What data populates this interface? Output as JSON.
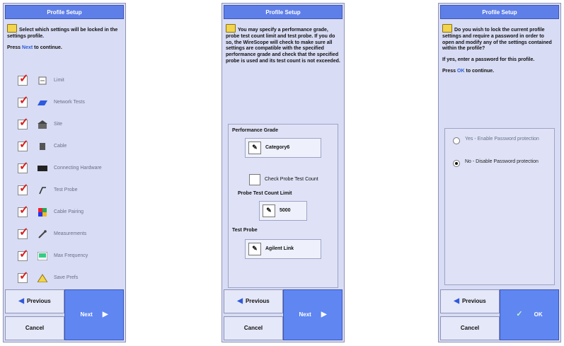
{
  "screen1": {
    "title": "Profile Setup",
    "intro": "Select which settings will be locked in the settings profile.",
    "press_prefix": "Press",
    "press_key": "Next",
    "press_suffix": "to continue.",
    "items": [
      {
        "label": "Limit",
        "icon": "limit-icon",
        "checked": true
      },
      {
        "label": "Network Tests",
        "icon": "network-tests-icon",
        "checked": true
      },
      {
        "label": "Site",
        "icon": "site-icon",
        "checked": true
      },
      {
        "label": "Cable",
        "icon": "cable-icon",
        "checked": true
      },
      {
        "label": "Connecting Hardware",
        "icon": "connecting-hardware-icon",
        "checked": true
      },
      {
        "label": "Test Probe",
        "icon": "test-probe-icon",
        "checked": true
      },
      {
        "label": "Cable Pairing",
        "icon": "cable-pairing-icon",
        "checked": true
      },
      {
        "label": "Measurements",
        "icon": "measurements-icon",
        "checked": true
      },
      {
        "label": "Max Frequency",
        "icon": "max-frequency-icon",
        "checked": true
      },
      {
        "label": "Save Prefs",
        "icon": "save-prefs-icon",
        "checked": true
      }
    ],
    "previous_label": "Previous",
    "cancel_label": "Cancel",
    "next_label": "Next"
  },
  "screen2": {
    "title": "Profile Setup",
    "intro": "You may specify a performance grade, probe test count limit and test probe. If you do so, the WireScope will check to make sure all settings are compatible with the specified performance grade and check that the specified probe is used and its test count is not exceeded.",
    "performance_grade_label": "Performance Grade",
    "performance_grade_value": "Category6",
    "check_probe_label": "Check Probe Test Count",
    "probe_limit_label": "Probe Test Count Limit",
    "probe_limit_value": "5000",
    "test_probe_label": "Test Probe",
    "test_probe_value": "Agilent Link",
    "previous_label": "Previous",
    "cancel_label": "Cancel",
    "next_label": "Next"
  },
  "screen3": {
    "title": "Profile Setup",
    "intro": "Do you wish to lock the current profile settings and require a password in order to open and modify any of the settings contained within the profile?",
    "intro2": "If yes, enter a password for this profile.",
    "press_prefix": "Press",
    "press_key": "OK",
    "press_suffix": "to continue.",
    "radio_yes": "Yes - Enable Password protection",
    "radio_no": "No - Disable Password protection",
    "selected": "no",
    "previous_label": "Previous",
    "cancel_label": "Cancel",
    "ok_label": "OK"
  },
  "colors": {
    "title_bar": "#5f7fe8",
    "next_button": "#5f86f1",
    "check_mark": "#d81f1f",
    "panel": "#d8dcf4"
  }
}
